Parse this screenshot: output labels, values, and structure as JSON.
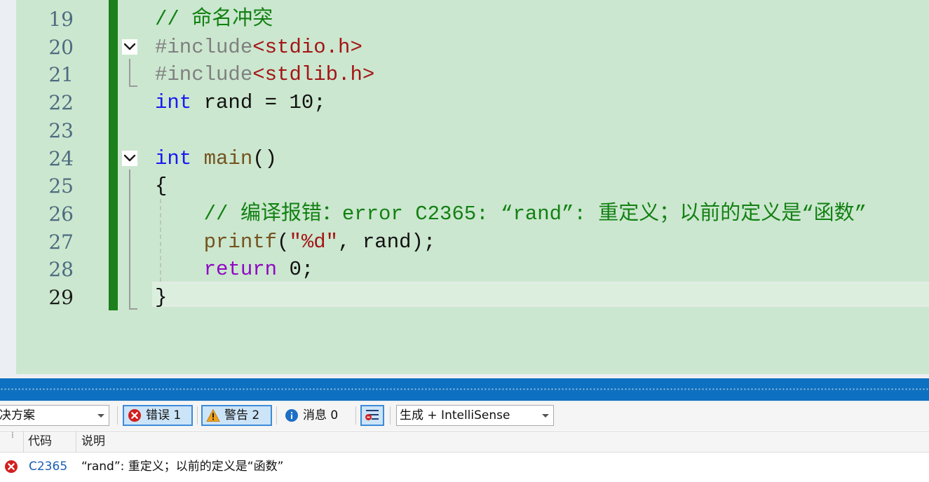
{
  "editor": {
    "lines": [
      {
        "no": "19",
        "current": false,
        "fold": false,
        "tokens": [
          {
            "t": "// 命名冲突",
            "c": "comment"
          }
        ]
      },
      {
        "no": "20",
        "current": false,
        "fold": true,
        "tokens": [
          {
            "t": "#include",
            "c": "pre"
          },
          {
            "t": "<stdio.h>",
            "c": "inc"
          }
        ]
      },
      {
        "no": "21",
        "current": false,
        "fold": false,
        "tokens": [
          {
            "t": "#include",
            "c": "pre"
          },
          {
            "t": "<stdlib.h>",
            "c": "inc"
          }
        ]
      },
      {
        "no": "22",
        "current": false,
        "fold": false,
        "tokens": [
          {
            "t": "int",
            "c": "kw"
          },
          {
            "t": " rand = 10;",
            "c": "plain"
          }
        ]
      },
      {
        "no": "23",
        "current": false,
        "fold": false,
        "tokens": []
      },
      {
        "no": "24",
        "current": false,
        "fold": true,
        "tokens": [
          {
            "t": "int",
            "c": "kw"
          },
          {
            "t": " ",
            "c": "plain"
          },
          {
            "t": "main",
            "c": "fn"
          },
          {
            "t": "()",
            "c": "plain"
          }
        ]
      },
      {
        "no": "25",
        "current": false,
        "fold": false,
        "tokens": [
          {
            "t": "{",
            "c": "plain"
          }
        ]
      },
      {
        "no": "26",
        "current": false,
        "fold": false,
        "tokens": [
          {
            "t": "    // 编译报错：error C2365: “rand”: 重定义；以前的定义是“函数”",
            "c": "comment"
          }
        ]
      },
      {
        "no": "27",
        "current": false,
        "fold": false,
        "tokens": [
          {
            "t": "    ",
            "c": "plain"
          },
          {
            "t": "printf",
            "c": "fn"
          },
          {
            "t": "(",
            "c": "plain"
          },
          {
            "t": "\"%d\"",
            "c": "str"
          },
          {
            "t": ", rand);",
            "c": "plain"
          }
        ]
      },
      {
        "no": "28",
        "current": false,
        "fold": false,
        "tokens": [
          {
            "t": "    ",
            "c": "plain"
          },
          {
            "t": "return",
            "c": "ret"
          },
          {
            "t": " 0;",
            "c": "plain"
          }
        ]
      },
      {
        "no": "29",
        "current": true,
        "fold": false,
        "tokens": [
          {
            "t": "}",
            "c": "plain"
          }
        ]
      }
    ]
  },
  "error_list": {
    "scope_dropdown": "决方案",
    "errors_label": "错误 1",
    "warnings_label": "警告 2",
    "messages_label": "消息 0",
    "filter_icon": "filter-icon",
    "source_dropdown": "生成 + IntelliSense",
    "columns": {
      "code": "代码",
      "description": "说明"
    },
    "rows": [
      {
        "severity_icon": "error-icon",
        "code": "C2365",
        "description": "“rand”: 重定义；以前的定义是“函数”"
      }
    ]
  },
  "colors": {
    "editor_background": "#cbe7cf",
    "change_bar": "#1b7f1b",
    "accent_blue": "#0e70c0",
    "error_red": "#d21f1f",
    "warning_amber": "#f0a21a"
  }
}
